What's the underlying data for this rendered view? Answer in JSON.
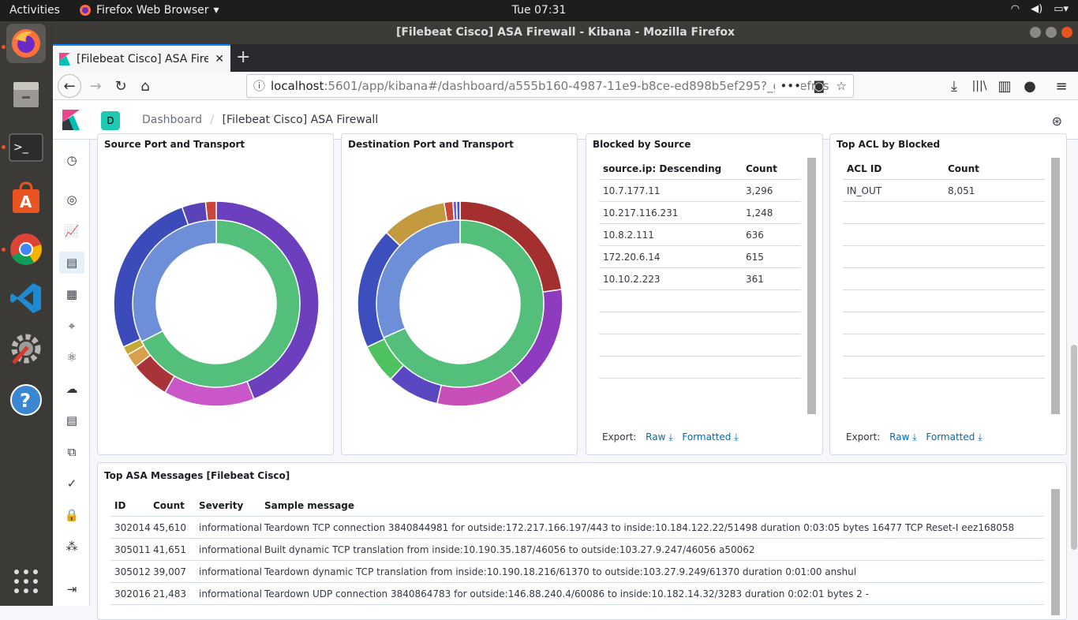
{
  "os": {
    "activities": "Activities",
    "app_menu": "Firefox Web Browser",
    "clock": "Tue 07:31"
  },
  "window": {
    "title": "[Filebeat Cisco] ASA Firewall - Kibana - Mozilla Firefox"
  },
  "browser": {
    "tab_title": "[Filebeat Cisco] ASA Firewall - Kibana",
    "url_host": "localhost",
    "url_rest": ":5601/app/kibana#/dashboard/a555b160-4987-11e9-b8ce-ed898b5ef295?_g=(refres"
  },
  "kibana": {
    "space_initial": "D",
    "breadcrumb_root": "Dashboard",
    "breadcrumb_sep": "/",
    "breadcrumb_current": "[Filebeat Cisco] ASA Firewall"
  },
  "panels": {
    "source_port": {
      "title": "Source Port and Transport"
    },
    "dest_port": {
      "title": "Destination Port and Transport"
    },
    "blocked_source": {
      "title": "Blocked by Source",
      "columns": [
        "source.ip: Descending",
        "Count"
      ],
      "rows": [
        [
          "10.7.177.11",
          "3,296"
        ],
        [
          "10.217.116.231",
          "1,248"
        ],
        [
          "10.8.2.111",
          "636"
        ],
        [
          "172.20.6.14",
          "615"
        ],
        [
          "10.10.2.223",
          "361"
        ]
      ],
      "export_label": "Export:",
      "raw": "Raw",
      "formatted": "Formatted"
    },
    "top_acl": {
      "title": "Top ACL by Blocked",
      "columns": [
        "ACL ID",
        "Count"
      ],
      "rows": [
        [
          "IN_OUT",
          "8,051"
        ]
      ],
      "export_label": "Export:",
      "raw": "Raw",
      "formatted": "Formatted"
    },
    "asa_messages": {
      "title": "Top ASA Messages [Filebeat Cisco]",
      "columns": [
        "ID",
        "Count",
        "Severity",
        "Sample message"
      ],
      "rows": [
        [
          "302014",
          "45,610",
          "informational",
          "Teardown TCP connection 3840844981 for outside:172.217.166.197/443 to inside:10.184.122.22/51498 duration 0:03:05 bytes 16477 TCP Reset-I eez168058"
        ],
        [
          "305011",
          "41,651",
          "informational",
          "Built dynamic TCP translation from inside:10.190.35.187/46056 to outside:103.27.9.247/46056 a50062"
        ],
        [
          "305012",
          "39,007",
          "informational",
          "Teardown dynamic TCP translation from inside:10.190.18.216/61370 to outside:103.27.9.249/61370 duration 0:01:00 anshul"
        ],
        [
          "302016",
          "21,483",
          "informational",
          "Teardown UDP connection 3840864783 for outside:146.88.240.4/60086 to inside:10.182.14.32/3283 duration 0:02:01 bytes 2 -"
        ]
      ]
    }
  },
  "colors": {
    "accent": "#006bb4",
    "kibana_pink": "#e8488b",
    "space_badge": "#1ec8b1"
  }
}
